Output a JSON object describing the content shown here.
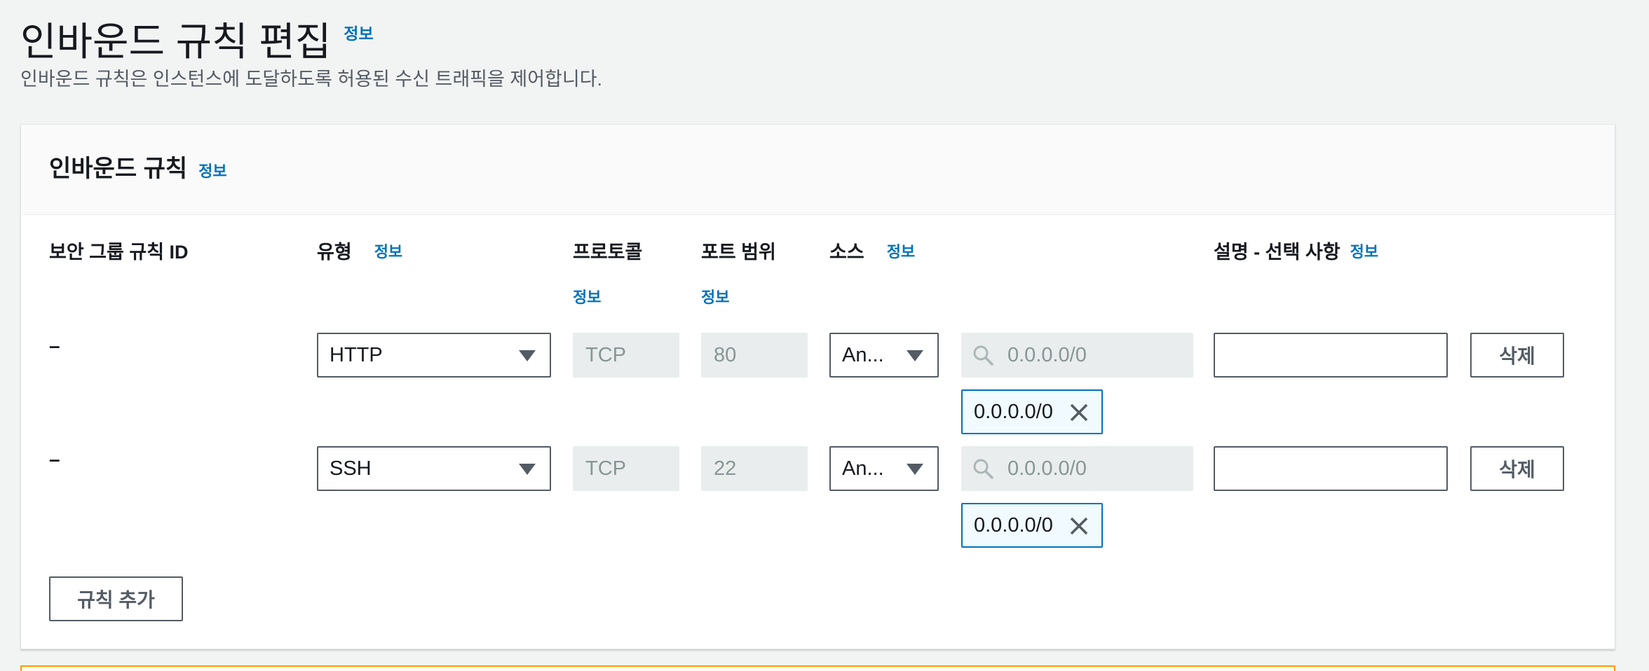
{
  "page": {
    "title": "인바운드 규칙 편집",
    "info": "정보",
    "description": "인바운드 규칙은 인스턴스에 도달하도록 허용된 수신 트래픽을 제어합니다."
  },
  "panel": {
    "title": "인바운드 규칙",
    "info": "정보"
  },
  "columns": {
    "rule_id": "보안 그룹 규칙 ID",
    "type": "유형",
    "protocol": "프로토콜",
    "port_range": "포트 범위",
    "source": "소스",
    "description": "설명 - 선택 사항",
    "info": "정보"
  },
  "rules": [
    {
      "rule_id": "–",
      "type": "HTTP",
      "protocol": "TCP",
      "port": "80",
      "source_type": "An...",
      "source_placeholder": "0.0.0.0/0",
      "source_token": "0.0.0.0/0",
      "description": "",
      "delete_label": "삭제"
    },
    {
      "rule_id": "–",
      "type": "SSH",
      "protocol": "TCP",
      "port": "22",
      "source_type": "An...",
      "source_placeholder": "0.0.0.0/0",
      "source_token": "0.0.0.0/0",
      "description": "",
      "delete_label": "삭제"
    }
  ],
  "add_rule_label": "규칙 추가",
  "colors": {
    "link": "#0073bb",
    "border": "#545b64",
    "disabled_bg": "#eaeded",
    "token_bg": "#f1faff",
    "warning": "#ff9900"
  }
}
